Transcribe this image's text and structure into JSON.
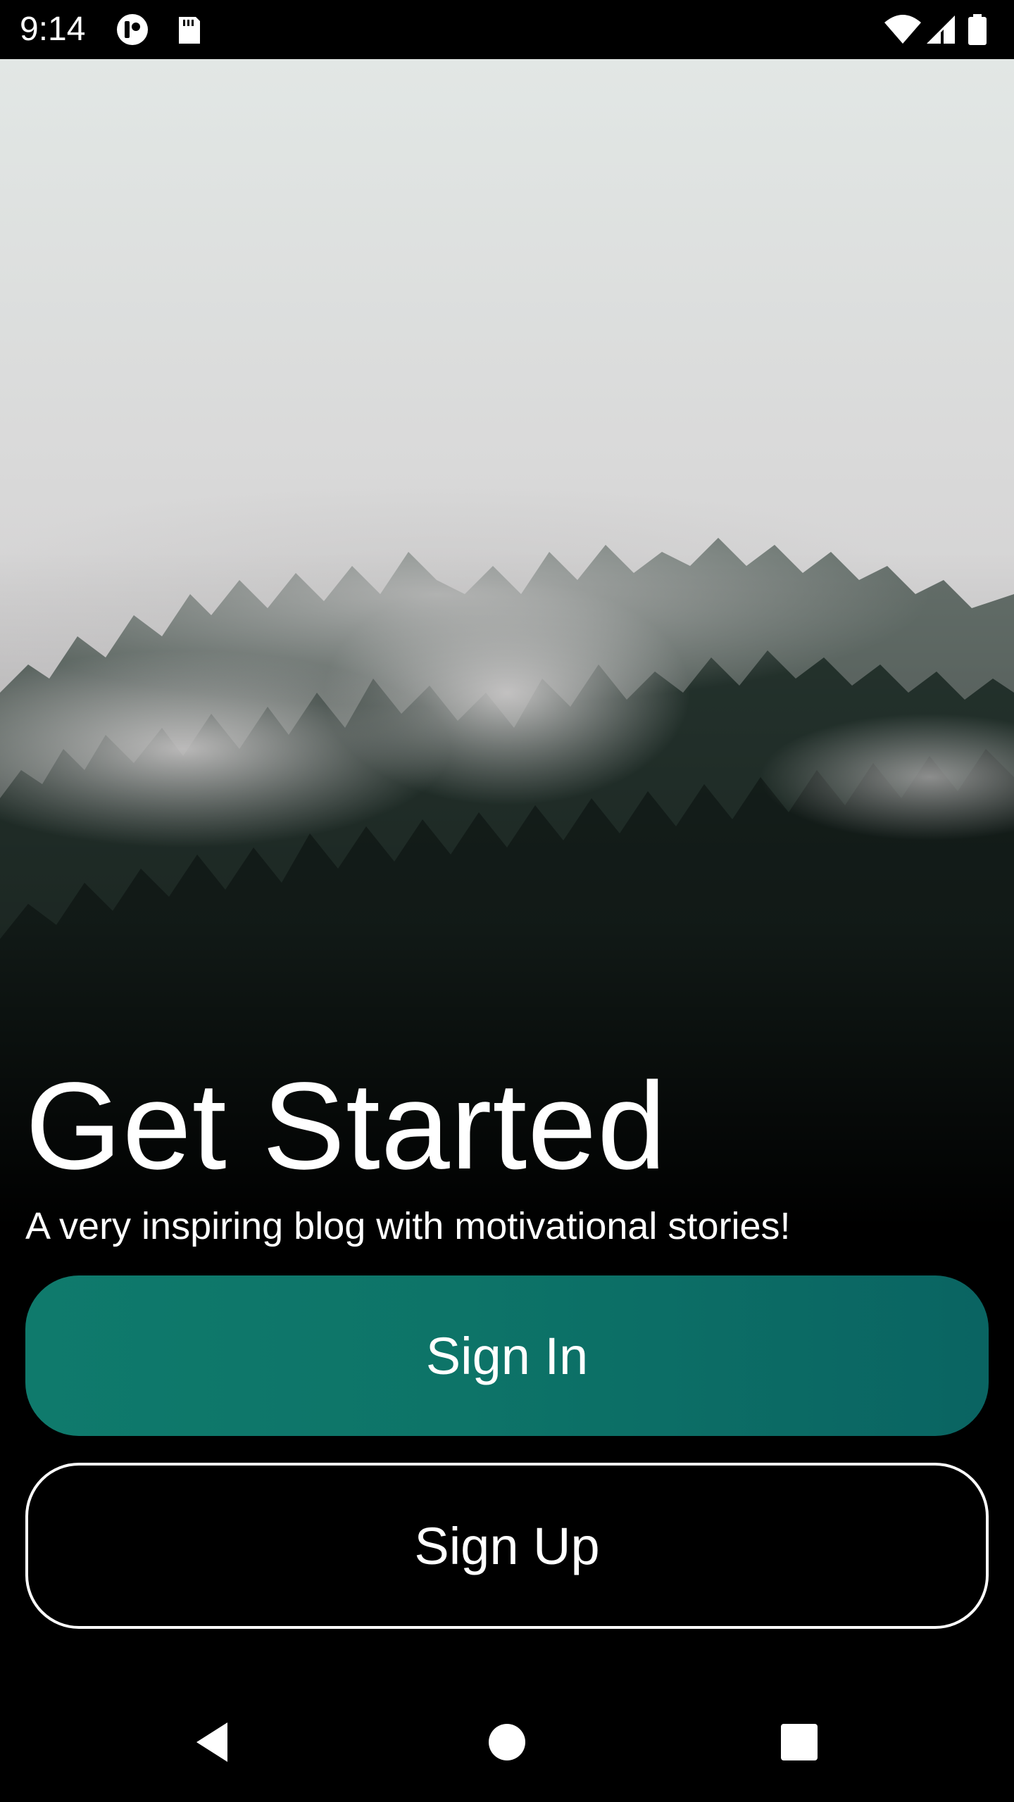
{
  "status_bar": {
    "time": "9:14",
    "icons": [
      "app-notification-icon",
      "sd-card-icon",
      "wifi-icon",
      "cell-signal-icon",
      "battery-icon"
    ]
  },
  "hero": {
    "image": "misty-forest-photo"
  },
  "content": {
    "title": "Get Started",
    "subtitle": "A very inspiring blog with motivational stories!"
  },
  "buttons": {
    "sign_in": "Sign In",
    "sign_up": "Sign Up"
  },
  "colors": {
    "primary_teal": "#0f7a6c",
    "background": "#000000",
    "text": "#ffffff"
  },
  "nav_bar": {
    "buttons": [
      "back-icon",
      "home-icon",
      "recents-icon"
    ]
  }
}
